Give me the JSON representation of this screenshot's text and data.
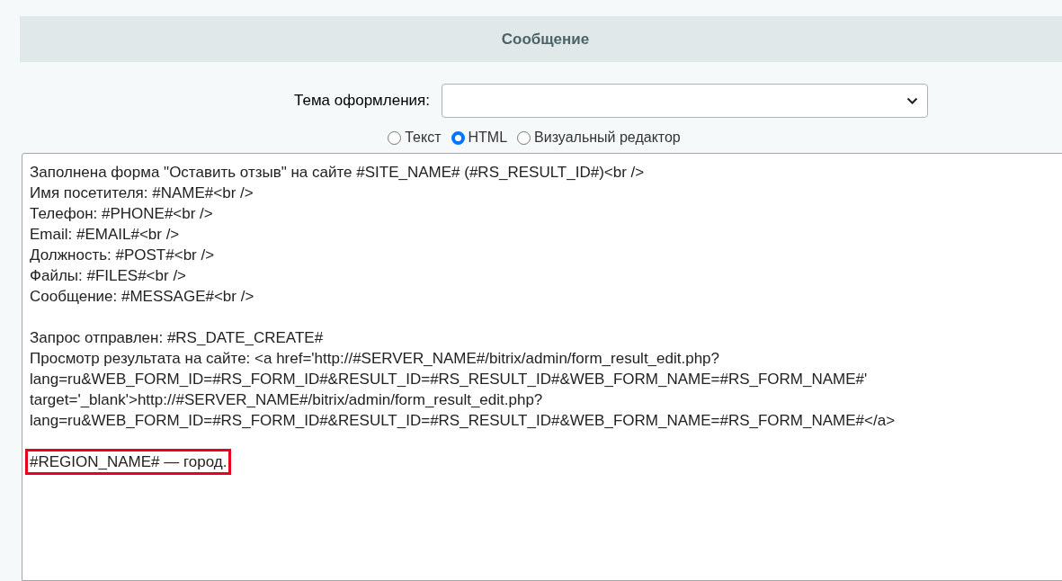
{
  "section": {
    "title": "Сообщение"
  },
  "theme": {
    "label": "Тема оформления:"
  },
  "modes": [
    {
      "label": "Текст",
      "selected": false
    },
    {
      "label": "HTML",
      "selected": true
    },
    {
      "label": "Визуальный редактор",
      "selected": false
    }
  ],
  "editor": {
    "paragraphs": [
      {
        "highlighted": false,
        "lines": [
          "Заполнена форма \"Оставить отзыв\" на сайте #SITE_NAME# (#RS_RESULT_ID#)<br />",
          "Имя посетителя: #NAME#<br />",
          "Телефон: #PHONE#<br />",
          "Email: #EMAIL#<br />",
          "Должность: #POST#<br />",
          "Файлы: #FILES#<br />",
          "Сообщение: #MESSAGE#<br />"
        ]
      },
      {
        "highlighted": false,
        "lines": [
          "Запрос отправлен: #RS_DATE_CREATE#",
          "Просмотр результата на сайте: <a href='http://#SERVER_NAME#/bitrix/admin/form_result_edit.php?",
          "lang=ru&WEB_FORM_ID=#RS_FORM_ID#&RESULT_ID=#RS_RESULT_ID#&WEB_FORM_NAME=#RS_FORM_NAME#'",
          "target='_blank'>http://#SERVER_NAME#/bitrix/admin/form_result_edit.php?",
          "lang=ru&WEB_FORM_ID=#RS_FORM_ID#&RESULT_ID=#RS_RESULT_ID#&WEB_FORM_NAME=#RS_FORM_NAME#</a>"
        ]
      },
      {
        "highlighted": true,
        "lines": [
          "#REGION_NAME# — город."
        ]
      }
    ]
  }
}
